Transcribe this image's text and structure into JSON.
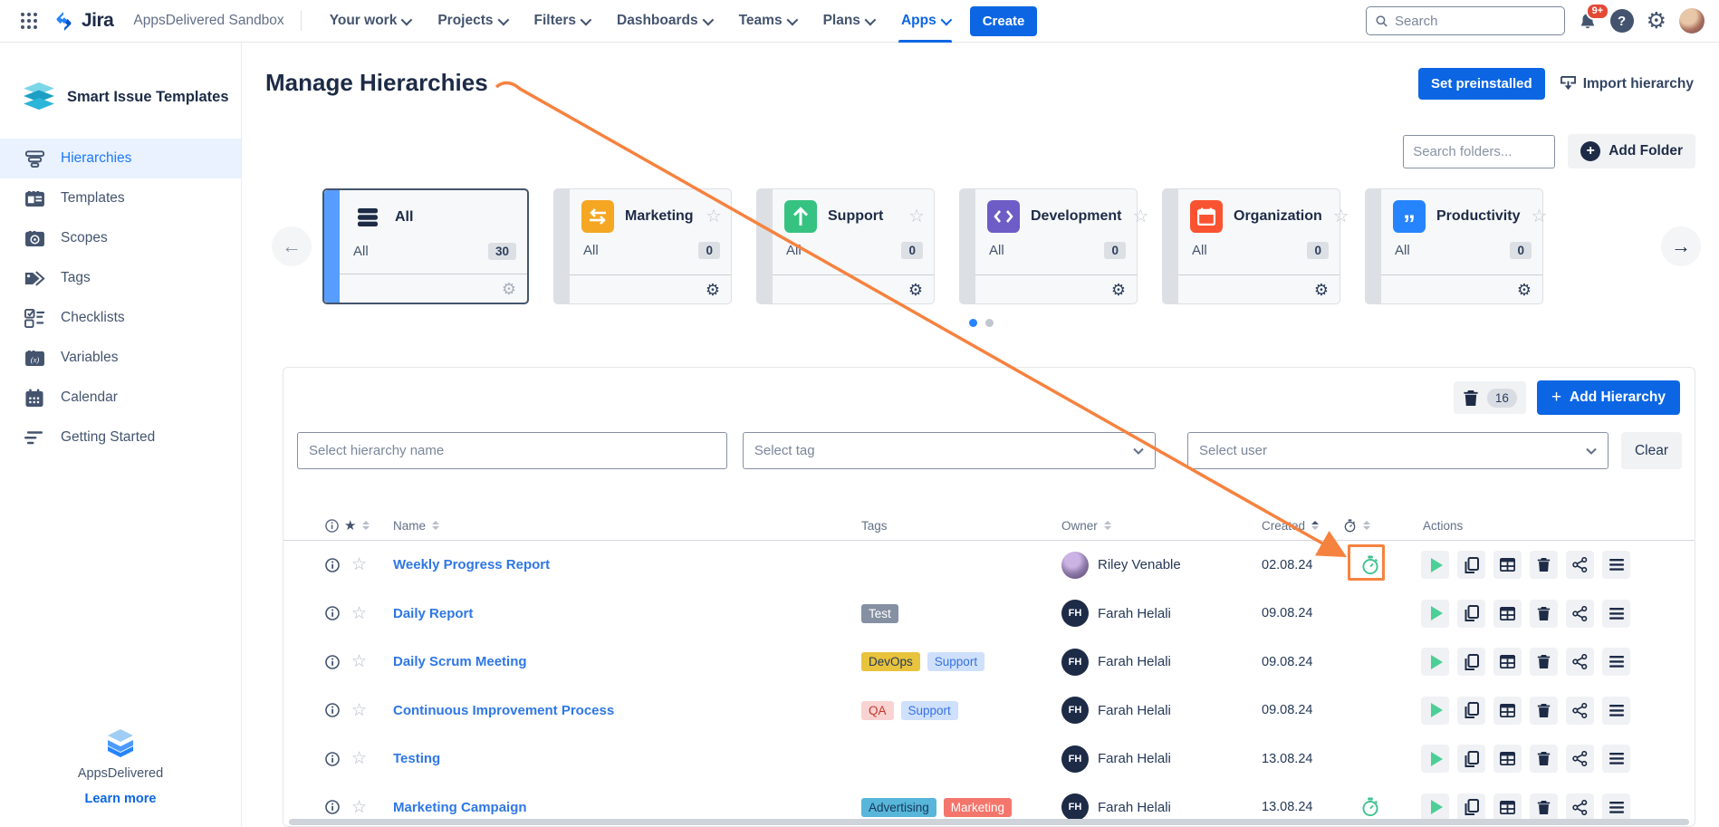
{
  "topnav": {
    "product": "Jira",
    "site_label": "AppsDelivered Sandbox",
    "menus": [
      "Your work",
      "Projects",
      "Filters",
      "Dashboards",
      "Teams",
      "Plans",
      "Apps"
    ],
    "active_menu": "Apps",
    "create_label": "Create",
    "search_placeholder": "Search",
    "notification_count": "9+"
  },
  "sidebar": {
    "app_title": "Smart Issue Templates",
    "items": [
      {
        "label": "Hierarchies",
        "icon": "hierarchies-icon",
        "active": true
      },
      {
        "label": "Templates",
        "icon": "templates-icon",
        "active": false
      },
      {
        "label": "Scopes",
        "icon": "scopes-icon",
        "active": false
      },
      {
        "label": "Tags",
        "icon": "tags-icon",
        "active": false
      },
      {
        "label": "Checklists",
        "icon": "checklists-icon",
        "active": false
      },
      {
        "label": "Variables",
        "icon": "variables-icon",
        "active": false
      },
      {
        "label": "Calendar",
        "icon": "calendar-icon",
        "active": false
      },
      {
        "label": "Getting Started",
        "icon": "getting-started-icon",
        "active": false
      }
    ],
    "footer_brand": "AppsDelivered",
    "footer_link": "Learn more"
  },
  "page": {
    "title": "Manage Hierarchies",
    "set_preinstalled_label": "Set preinstalled",
    "import_label": "Import hierarchy"
  },
  "folders": {
    "search_placeholder": "Search folders...",
    "add_folder_label": "Add Folder",
    "cards": [
      {
        "name": "All",
        "scope": "All",
        "count": "30",
        "icon": "stack",
        "icon_bg": "none",
        "selected": true,
        "has_star": false
      },
      {
        "name": "Marketing",
        "scope": "All",
        "count": "0",
        "icon": "swap",
        "icon_bg": "#f5a623",
        "selected": false,
        "has_star": true
      },
      {
        "name": "Support",
        "scope": "All",
        "count": "0",
        "icon": "arrow-up",
        "icon_bg": "#36c281",
        "selected": false,
        "has_star": true
      },
      {
        "name": "Development",
        "scope": "All",
        "count": "0",
        "icon": "code",
        "icon_bg": "#6e5dc6",
        "selected": false,
        "has_star": true
      },
      {
        "name": "Organization",
        "scope": "All",
        "count": "0",
        "icon": "calendar",
        "icon_bg": "#fa5332",
        "selected": false,
        "has_star": true
      },
      {
        "name": "Productivity",
        "scope": "All",
        "count": "0",
        "icon": "quote",
        "icon_bg": "#2684ff",
        "selected": false,
        "has_star": true
      }
    ],
    "dots": [
      {
        "active": true
      },
      {
        "active": false
      }
    ]
  },
  "list": {
    "delete_badge": "16",
    "add_hierarchy_label": "Add Hierarchy",
    "filters": {
      "name_placeholder": "Select hierarchy name",
      "tag_placeholder": "Select tag",
      "user_placeholder": "Select user",
      "clear_label": "Clear"
    },
    "columns": {
      "name": "Name",
      "tags": "Tags",
      "owner": "Owner",
      "created": "Created",
      "actions": "Actions"
    },
    "rows": [
      {
        "name": "Weekly Progress Report",
        "tags": [],
        "owner": "Riley Venable",
        "avatar": "photo",
        "created": "02.08.24",
        "scheduled": true,
        "annotated": true
      },
      {
        "name": "Daily Report",
        "tags": [
          {
            "label": "Test",
            "bg": "#8590a2",
            "fg": "#ffffff"
          }
        ],
        "owner": "Farah Helali",
        "avatar": "FH",
        "created": "09.08.24",
        "scheduled": false,
        "annotated": false
      },
      {
        "name": "Daily Scrum Meeting",
        "tags": [
          {
            "label": "DevOps",
            "bg": "#e8c33d",
            "fg": "#253858"
          },
          {
            "label": "Support",
            "bg": "#cfe0fc",
            "fg": "#3572e3"
          }
        ],
        "owner": "Farah Helali",
        "avatar": "FH",
        "created": "09.08.24",
        "scheduled": false,
        "annotated": false
      },
      {
        "name": "Continuous Improvement Process",
        "tags": [
          {
            "label": "QA",
            "bg": "#f9d3d1",
            "fg": "#c9372c"
          },
          {
            "label": "Support",
            "bg": "#cfe0fc",
            "fg": "#3572e3"
          }
        ],
        "owner": "Farah Helali",
        "avatar": "FH",
        "created": "09.08.24",
        "scheduled": false,
        "annotated": false
      },
      {
        "name": "Testing",
        "tags": [],
        "owner": "Farah Helali",
        "avatar": "FH",
        "created": "13.08.24",
        "scheduled": false,
        "annotated": false
      },
      {
        "name": "Marketing Campaign",
        "tags": [
          {
            "label": "Advertising",
            "bg": "#57b6d9",
            "fg": "#17375c"
          },
          {
            "label": "Marketing",
            "bg": "#f4756b",
            "fg": "#ffffff"
          }
        ],
        "owner": "Farah Helali",
        "avatar": "FH",
        "created": "13.08.24",
        "scheduled": true,
        "annotated": false
      }
    ]
  },
  "colors": {
    "accent_blue": "#0c66e4",
    "annotation_orange": "#f6823f",
    "timer_green": "#3ec28f",
    "link_blue": "#2e77e5"
  }
}
